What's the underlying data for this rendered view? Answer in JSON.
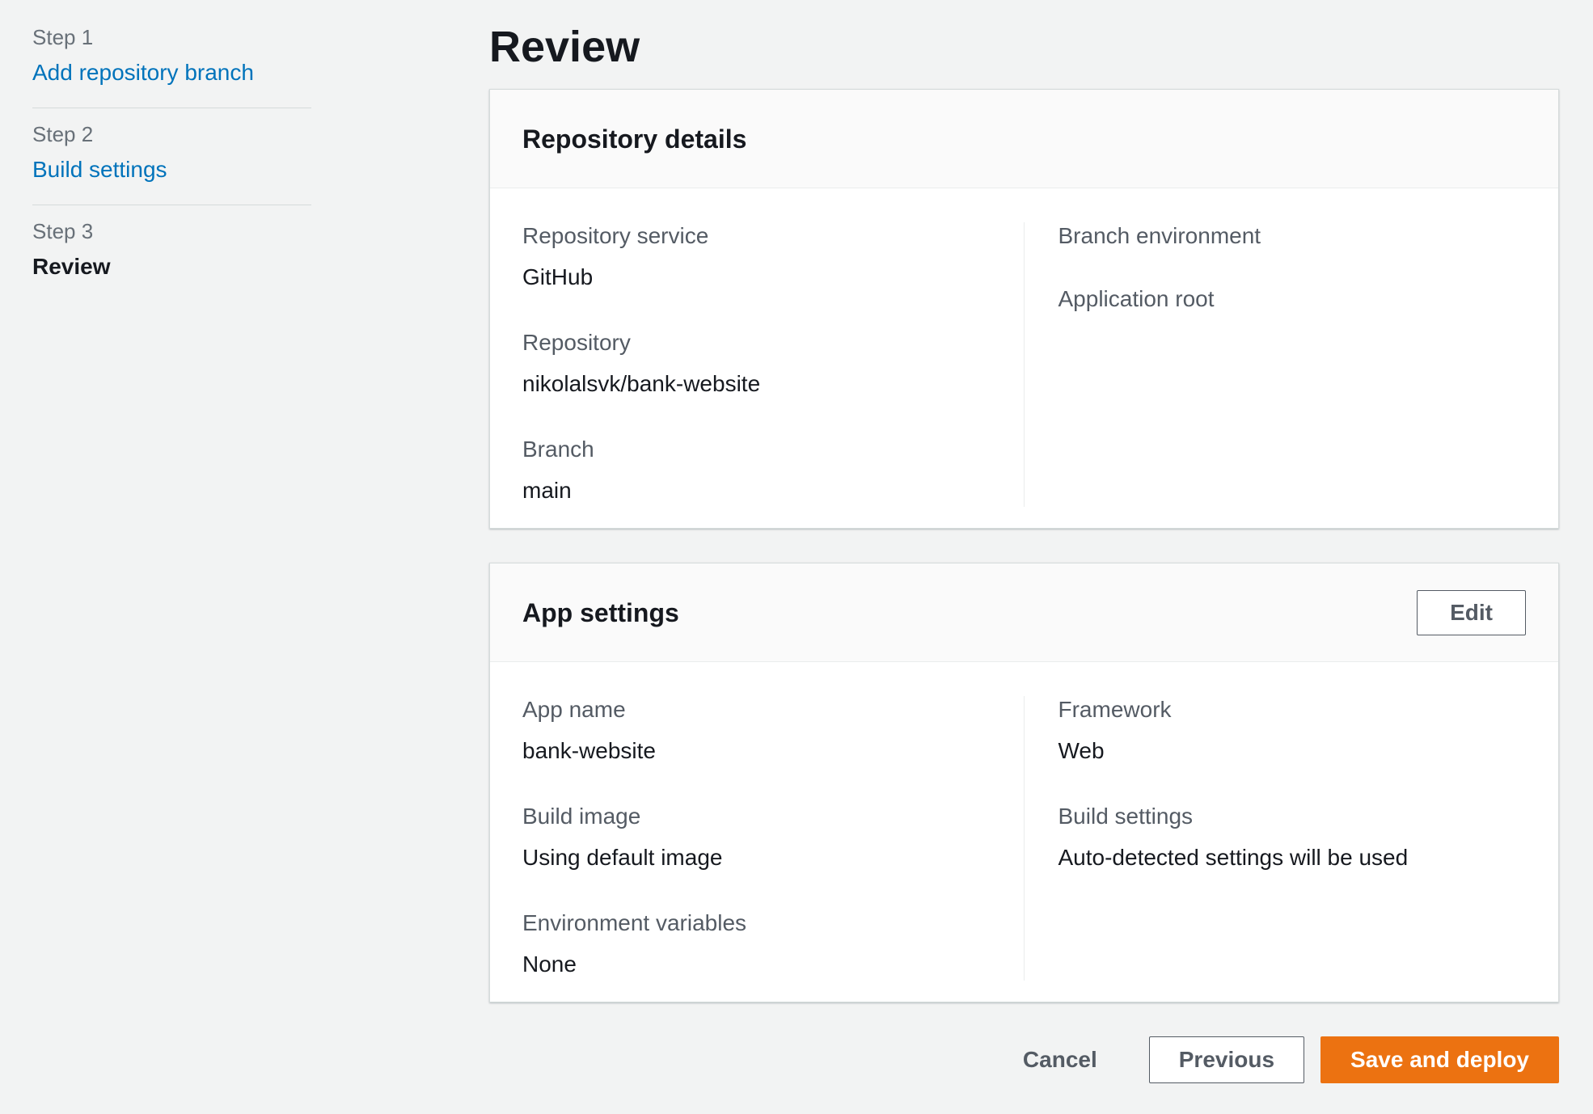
{
  "page": {
    "title": "Review"
  },
  "sidebar": {
    "steps": [
      {
        "step_label": "Step 1",
        "title": "Add repository branch"
      },
      {
        "step_label": "Step 2",
        "title": "Build settings"
      },
      {
        "step_label": "Step 3",
        "title": "Review"
      }
    ]
  },
  "cards": [
    {
      "title": "Repository details",
      "left": [
        {
          "label": "Repository service",
          "value": "GitHub"
        },
        {
          "label": "Repository",
          "value": "nikolalsvk/bank-website"
        },
        {
          "label": "Branch",
          "value": "main"
        }
      ],
      "right": [
        {
          "label": "Branch environment",
          "value": ""
        },
        {
          "label": "Application root",
          "value": ""
        }
      ]
    },
    {
      "title": "App settings",
      "edit_label": "Edit",
      "left": [
        {
          "label": "App name",
          "value": "bank-website"
        },
        {
          "label": "Build image",
          "value": "Using default image"
        },
        {
          "label": "Environment variables",
          "value": "None"
        }
      ],
      "right": [
        {
          "label": "Framework",
          "value": "Web"
        },
        {
          "label": "Build settings",
          "value": "Auto-detected settings will be used"
        }
      ]
    }
  ],
  "footer": {
    "cancel_label": "Cancel",
    "previous_label": "Previous",
    "submit_label": "Save and deploy"
  },
  "colors": {
    "primary_button": "#ec7211",
    "link_blue": "#0073bb",
    "page_background": "#f2f3f3",
    "label_gray": "#545b64",
    "text_dark": "#16191f"
  }
}
